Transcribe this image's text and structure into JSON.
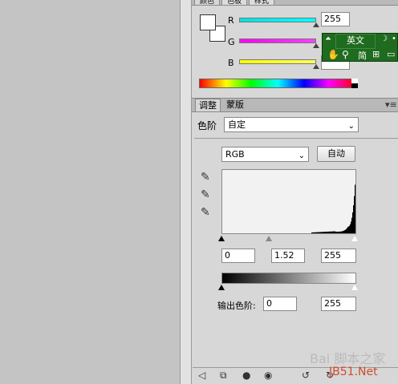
{
  "colorPanel": {
    "tabs": [
      "颜色",
      "色板",
      "样式"
    ],
    "channels": [
      {
        "label": "R",
        "value": "255",
        "color": "#00e5e5"
      },
      {
        "label": "G",
        "value": "",
        "color": "#e000e0"
      },
      {
        "label": "B",
        "value": "",
        "color": "#e8e800"
      }
    ]
  },
  "ime": {
    "lang": "英文",
    "mode": "简"
  },
  "adjustments": {
    "tabs": [
      "调整",
      "蒙版"
    ],
    "header": "色阶",
    "preset": "自定",
    "channel": "RGB",
    "auto_label": "自动",
    "input_levels": [
      "0",
      "1.52",
      "255"
    ],
    "output_label": "输出色阶:",
    "output_levels": [
      "0",
      "255"
    ]
  },
  "watermark": {
    "line1": "Bai 脚本之家",
    "line2": "JB51.Net"
  },
  "histogram": [
    0,
    0,
    0,
    0,
    0,
    0,
    0,
    0,
    0,
    0,
    0,
    0,
    0,
    0,
    0,
    0,
    0,
    0,
    0,
    0,
    0,
    0,
    0,
    0,
    0,
    0,
    0,
    0,
    0,
    0,
    0,
    0,
    0,
    0,
    0,
    0,
    0,
    0,
    0,
    0,
    0,
    0,
    0,
    0,
    0,
    0,
    0,
    0,
    0,
    0,
    0,
    0,
    0,
    0,
    0,
    0,
    0,
    0,
    0,
    0,
    0,
    0,
    0,
    0,
    0,
    0,
    0,
    0,
    0,
    0,
    0,
    0,
    0,
    0,
    0,
    0,
    0,
    0,
    0,
    0,
    0,
    0,
    0,
    0,
    0,
    0,
    0,
    0,
    0,
    0,
    0,
    0,
    0,
    0,
    0,
    0,
    0,
    0,
    0,
    0,
    0,
    0,
    0,
    0,
    0,
    0,
    0,
    0,
    0,
    0,
    0,
    0,
    0,
    0,
    0,
    0,
    0,
    0,
    0,
    0,
    0,
    0,
    0,
    0,
    0,
    0,
    0,
    0,
    0,
    0,
    0,
    0,
    0,
    0,
    0,
    0,
    0,
    0,
    0,
    0,
    0,
    0,
    0,
    0,
    0,
    0,
    0,
    0,
    0,
    0,
    0,
    0,
    0,
    0,
    0,
    0,
    0,
    0,
    0,
    0,
    0,
    0,
    0,
    0,
    0,
    0,
    0,
    0,
    0,
    0,
    0,
    0,
    0,
    0,
    0,
    0,
    0,
    0,
    0,
    0,
    0,
    0,
    0,
    0,
    0,
    0,
    0,
    0,
    0,
    0,
    0,
    0,
    0,
    0,
    0,
    0,
    0,
    0,
    0,
    0,
    0,
    0,
    0,
    0,
    0,
    0,
    0,
    0,
    0,
    0,
    0,
    0,
    0,
    0,
    0,
    0,
    0,
    0,
    0,
    0,
    0,
    0,
    0,
    0,
    0,
    0,
    0,
    0,
    0,
    0,
    0,
    0,
    0,
    0,
    0,
    0,
    0,
    0,
    0,
    0,
    0,
    0,
    0,
    0,
    0,
    0,
    0,
    0,
    0,
    0,
    0,
    0,
    0,
    0,
    0,
    0,
    0,
    0,
    0,
    0,
    0,
    0,
    0,
    0,
    0,
    0,
    0,
    0,
    0,
    0,
    0,
    0,
    0,
    0,
    0,
    0
  ]
}
